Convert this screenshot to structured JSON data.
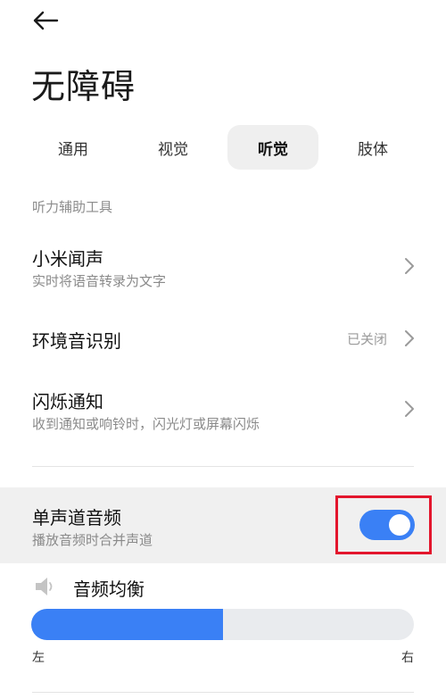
{
  "header": {
    "back_icon": "arrow-left-icon",
    "title": "无障碍"
  },
  "tabs": [
    {
      "label": "通用",
      "active": false
    },
    {
      "label": "视觉",
      "active": false
    },
    {
      "label": "听觉",
      "active": true
    },
    {
      "label": "肢体",
      "active": false
    }
  ],
  "section": {
    "label": "听力辅助工具"
  },
  "items": {
    "mi_sound": {
      "title": "小米闻声",
      "subtitle": "实时将语音转录为文字"
    },
    "ambient": {
      "title": "环境音识别",
      "status": "已关闭"
    },
    "flash": {
      "title": "闪烁通知",
      "subtitle": "收到通知或响铃时，闪光灯或屏幕闪烁"
    }
  },
  "mono_audio": {
    "title": "单声道音频",
    "subtitle": "播放音频时合并声道",
    "enabled": true
  },
  "balance": {
    "title": "音频均衡",
    "icon": "speaker-icon",
    "left_label": "左",
    "right_label": "右",
    "value_fraction": 0.5
  },
  "colors": {
    "accent": "#3a80f5",
    "highlight": "#e3162d"
  }
}
